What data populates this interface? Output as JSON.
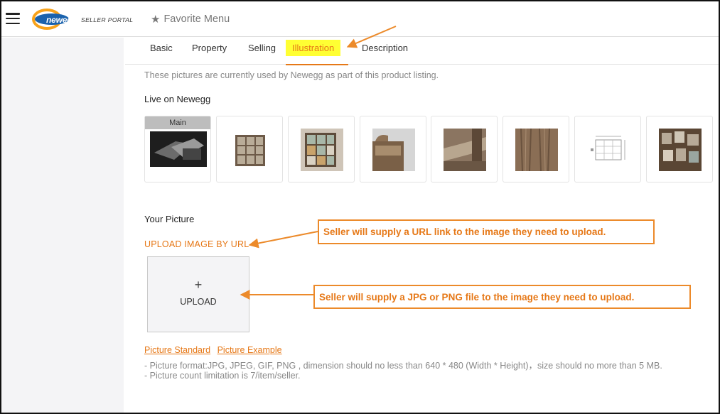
{
  "header": {
    "logo_word": "newegg",
    "logo_portal": "SELLER PORTAL",
    "favorite_menu": "Favorite Menu"
  },
  "tabs": [
    {
      "label": "Basic"
    },
    {
      "label": "Property"
    },
    {
      "label": "Selling"
    },
    {
      "label": "Illustration",
      "active": true
    },
    {
      "label": "Description"
    }
  ],
  "content": {
    "description": "These pictures are currently used by Newegg as part of this product listing.",
    "live_title": "Live on Newegg",
    "main_badge": "Main",
    "your_picture_title": "Your Picture",
    "upload_by_url": "UPLOAD IMAGE BY URL",
    "upload_plus": "+",
    "upload_label": "UPLOAD",
    "link_picture_standard": "Picture Standard",
    "link_picture_example": "Picture Example",
    "note_format": "- Picture format:JPG, JPEG, GIF, PNG , dimension should no less than 640 * 480 (Width * Height)，size should no more than 5 MB.",
    "note_count": "- Picture count limitation is 7/item/seller."
  },
  "callouts": {
    "url_callout": "Seller will supply a URL link to the image they need to upload.",
    "file_callout": "Seller will supply a JPG or PNG file to the image they need to upload."
  },
  "colors": {
    "accent": "#e67817",
    "highlight": "#ffff33",
    "sidebar": "#f4f4f6",
    "callout_border": "#ec8a2a"
  },
  "icons": [
    "menu-icon",
    "star-icon",
    "plus-icon"
  ]
}
